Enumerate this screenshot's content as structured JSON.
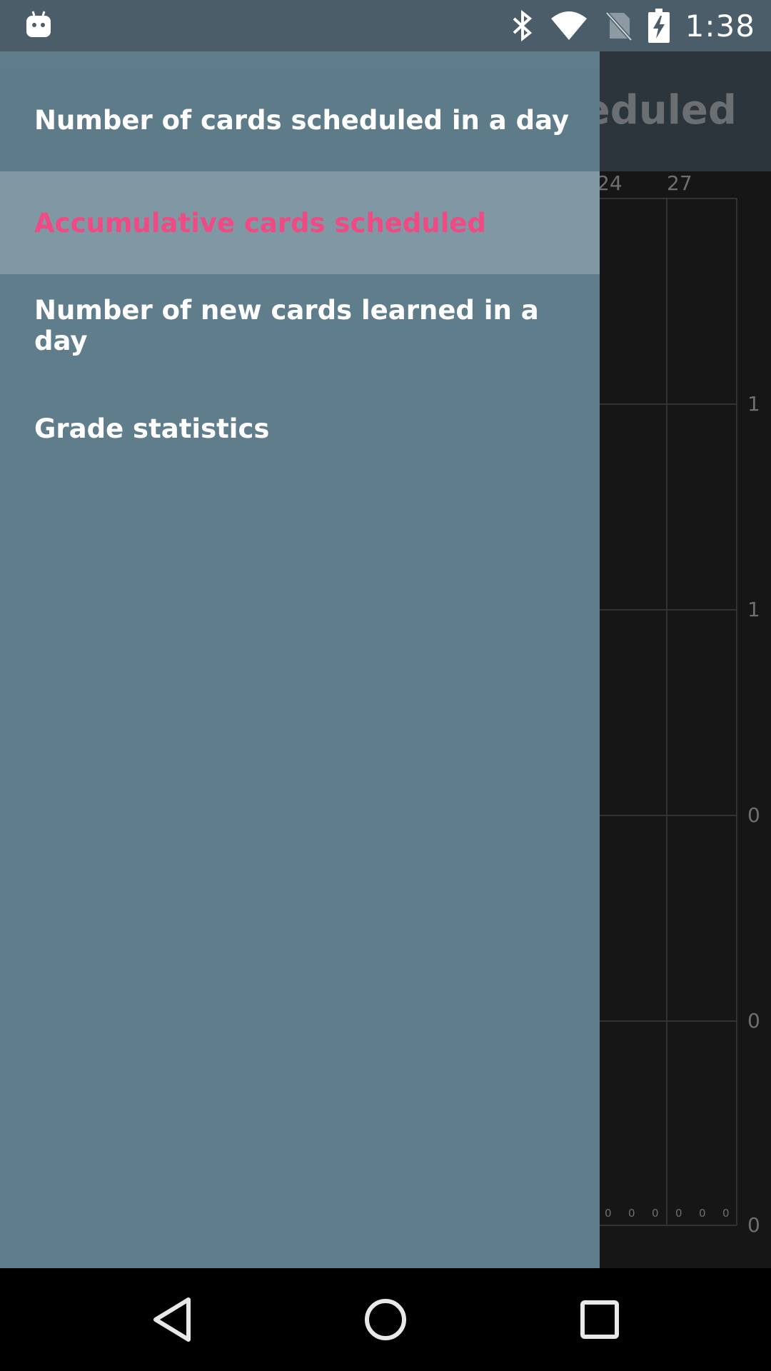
{
  "status_bar": {
    "time": "1:38",
    "icons": [
      "android-icon",
      "bluetooth-icon",
      "wifi-icon",
      "no-sim-icon",
      "battery-charging-icon"
    ]
  },
  "app": {
    "title_visible": "heduled"
  },
  "chart": {
    "top_ticks": [
      "24",
      "27"
    ],
    "right_ticks": [
      "1",
      "1",
      "0",
      "0",
      "0"
    ],
    "bar_labels": [
      "0",
      "0",
      "0",
      "0",
      "0",
      "0"
    ]
  },
  "drawer": {
    "items": [
      {
        "label": "Number of cards scheduled in a day",
        "selected": false
      },
      {
        "label": "Accumulative cards scheduled",
        "selected": true
      },
      {
        "label": "Number of new cards learned in a day",
        "selected": false
      },
      {
        "label": "Grade statistics",
        "selected": false
      }
    ]
  },
  "nav_bar": {
    "icons": [
      "back-icon",
      "home-icon",
      "recents-icon"
    ]
  },
  "colors": {
    "drawer_bg": "#607d8b",
    "selected_bg": "#7f98a4",
    "accent_pink": "#f04a84",
    "status_bar": "#4b5d69"
  }
}
